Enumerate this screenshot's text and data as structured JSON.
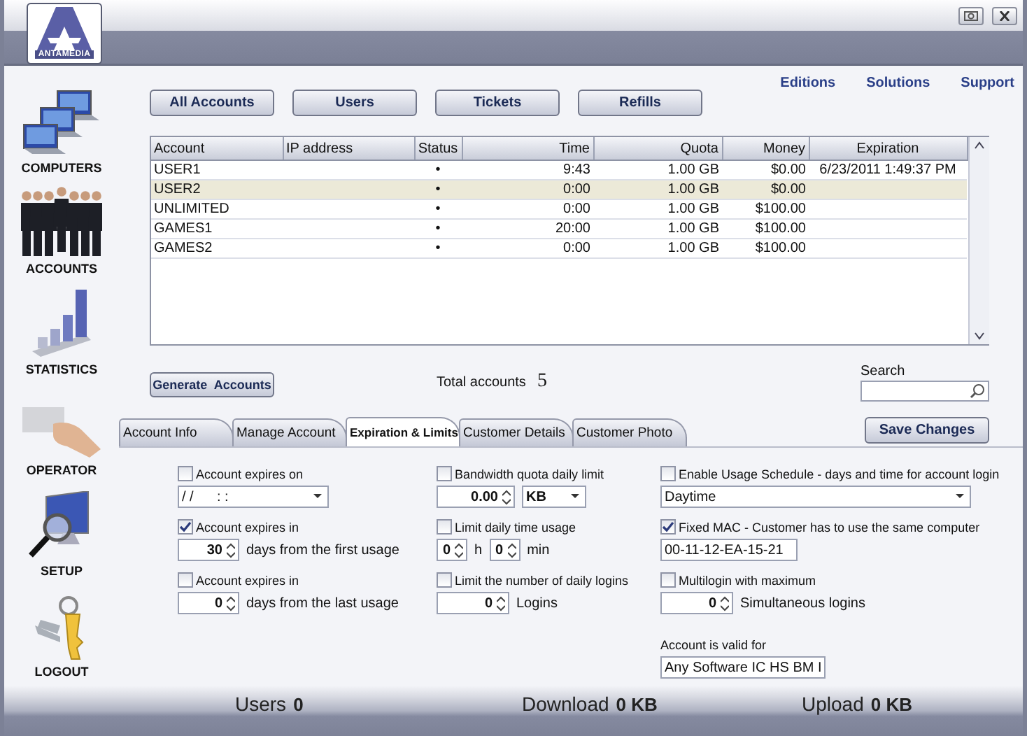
{
  "window": {
    "logo": "ANTAMEDIA"
  },
  "top_links": [
    "Editions",
    "Solutions",
    "Support"
  ],
  "sidebar": {
    "items": [
      {
        "label": "COMPUTERS"
      },
      {
        "label": "ACCOUNTS"
      },
      {
        "label": "STATISTICS"
      },
      {
        "label": "OPERATOR"
      },
      {
        "label": "SETUP"
      },
      {
        "label": "LOGOUT"
      }
    ]
  },
  "view_buttons": [
    "All Accounts",
    "Users",
    "Tickets",
    "Refills"
  ],
  "table": {
    "columns": [
      "Account",
      "IP address",
      "Status",
      "Time",
      "Quota",
      "Money",
      "Expiration"
    ],
    "rows": [
      {
        "selected": false,
        "cells": [
          "USER1",
          "",
          "•",
          "9:43",
          "1.00 GB",
          "$0.00",
          "6/23/2011 1:49:37 PM"
        ]
      },
      {
        "selected": true,
        "cells": [
          "USER2",
          "",
          "•",
          "0:00",
          "1.00 GB",
          "$0.00",
          ""
        ]
      },
      {
        "selected": false,
        "cells": [
          "UNLIMITED",
          "",
          "•",
          "0:00",
          "1.00 GB",
          "$100.00",
          ""
        ]
      },
      {
        "selected": false,
        "cells": [
          "GAMES1",
          "",
          "•",
          "20:00",
          "1.00 GB",
          "$100.00",
          ""
        ]
      },
      {
        "selected": false,
        "cells": [
          "GAMES2",
          "",
          "•",
          "0:00",
          "1.00 GB",
          "$100.00",
          ""
        ]
      }
    ]
  },
  "generate_button": "Generate  Accounts",
  "total": {
    "label": "Total accounts",
    "value": "5"
  },
  "search": {
    "label": "Search"
  },
  "tabs": [
    {
      "label": "Account Info",
      "selected": false
    },
    {
      "label": "Manage Account",
      "selected": false
    },
    {
      "label": "Expiration & Limits",
      "selected": true
    },
    {
      "label": "Customer Details",
      "selected": false
    },
    {
      "label": "Customer Photo",
      "selected": false
    }
  ],
  "save_button": "Save Changes",
  "form": {
    "columns": [
      {
        "options": [
          {
            "kind": "checkbox",
            "label": "Account expires on",
            "checked": false,
            "controls": [
              {
                "kind": "select",
                "value": "/ /      : :"
              }
            ]
          },
          {
            "kind": "checkbox",
            "label": "Account expires in",
            "checked": true,
            "controls": [
              {
                "kind": "spin",
                "value": "30"
              },
              {
                "kind": "unit",
                "value": "days from the first usage"
              }
            ]
          },
          {
            "kind": "checkbox",
            "label": "Account expires in",
            "checked": false,
            "controls": [
              {
                "kind": "spin",
                "value": "0"
              },
              {
                "kind": "unit",
                "value": "days from the last usage"
              }
            ]
          }
        ]
      },
      {
        "options": [
          {
            "kind": "checkbox",
            "label": "Bandwidth quota daily limit",
            "checked": false,
            "controls": [
              {
                "kind": "spin",
                "value": "0.00"
              },
              {
                "kind": "select",
                "value": "KB"
              }
            ]
          },
          {
            "kind": "checkbox",
            "label": "Limit daily time usage",
            "checked": false,
            "controls": [
              {
                "kind": "spin",
                "value": "0"
              },
              {
                "kind": "unit",
                "value": "h"
              },
              {
                "kind": "spin",
                "value": "0"
              },
              {
                "kind": "unit",
                "value": "min"
              }
            ]
          },
          {
            "kind": "checkbox",
            "label": "Limit the number of daily logins",
            "checked": false,
            "controls": [
              {
                "kind": "spin",
                "value": "0"
              },
              {
                "kind": "unit",
                "value": "Logins"
              }
            ]
          }
        ]
      },
      {
        "options": [
          {
            "kind": "checkbox",
            "label": "Enable Usage Schedule - days and time for account login",
            "checked": false,
            "controls": [
              {
                "kind": "select",
                "value": "Daytime"
              }
            ]
          },
          {
            "kind": "checkbox",
            "label": "Fixed MAC - Customer has to use the same computer",
            "checked": true,
            "controls": [
              {
                "kind": "text",
                "value": "00-11-12-EA-15-21"
              }
            ]
          },
          {
            "kind": "checkbox",
            "label": "Multilogin with maximum",
            "checked": false,
            "controls": [
              {
                "kind": "spin",
                "value": "0"
              },
              {
                "kind": "unit",
                "value": "Simultaneous logins"
              }
            ]
          },
          {
            "kind": "field",
            "label": "Account is valid for",
            "controls": [
              {
                "kind": "select",
                "value": "Any Software IC HS BM I"
              }
            ]
          }
        ]
      }
    ]
  },
  "status_bar": [
    {
      "label": "Users",
      "value": "0"
    },
    {
      "label": "Download",
      "value": "0 KB"
    },
    {
      "label": "Upload",
      "value": "0 KB"
    }
  ]
}
